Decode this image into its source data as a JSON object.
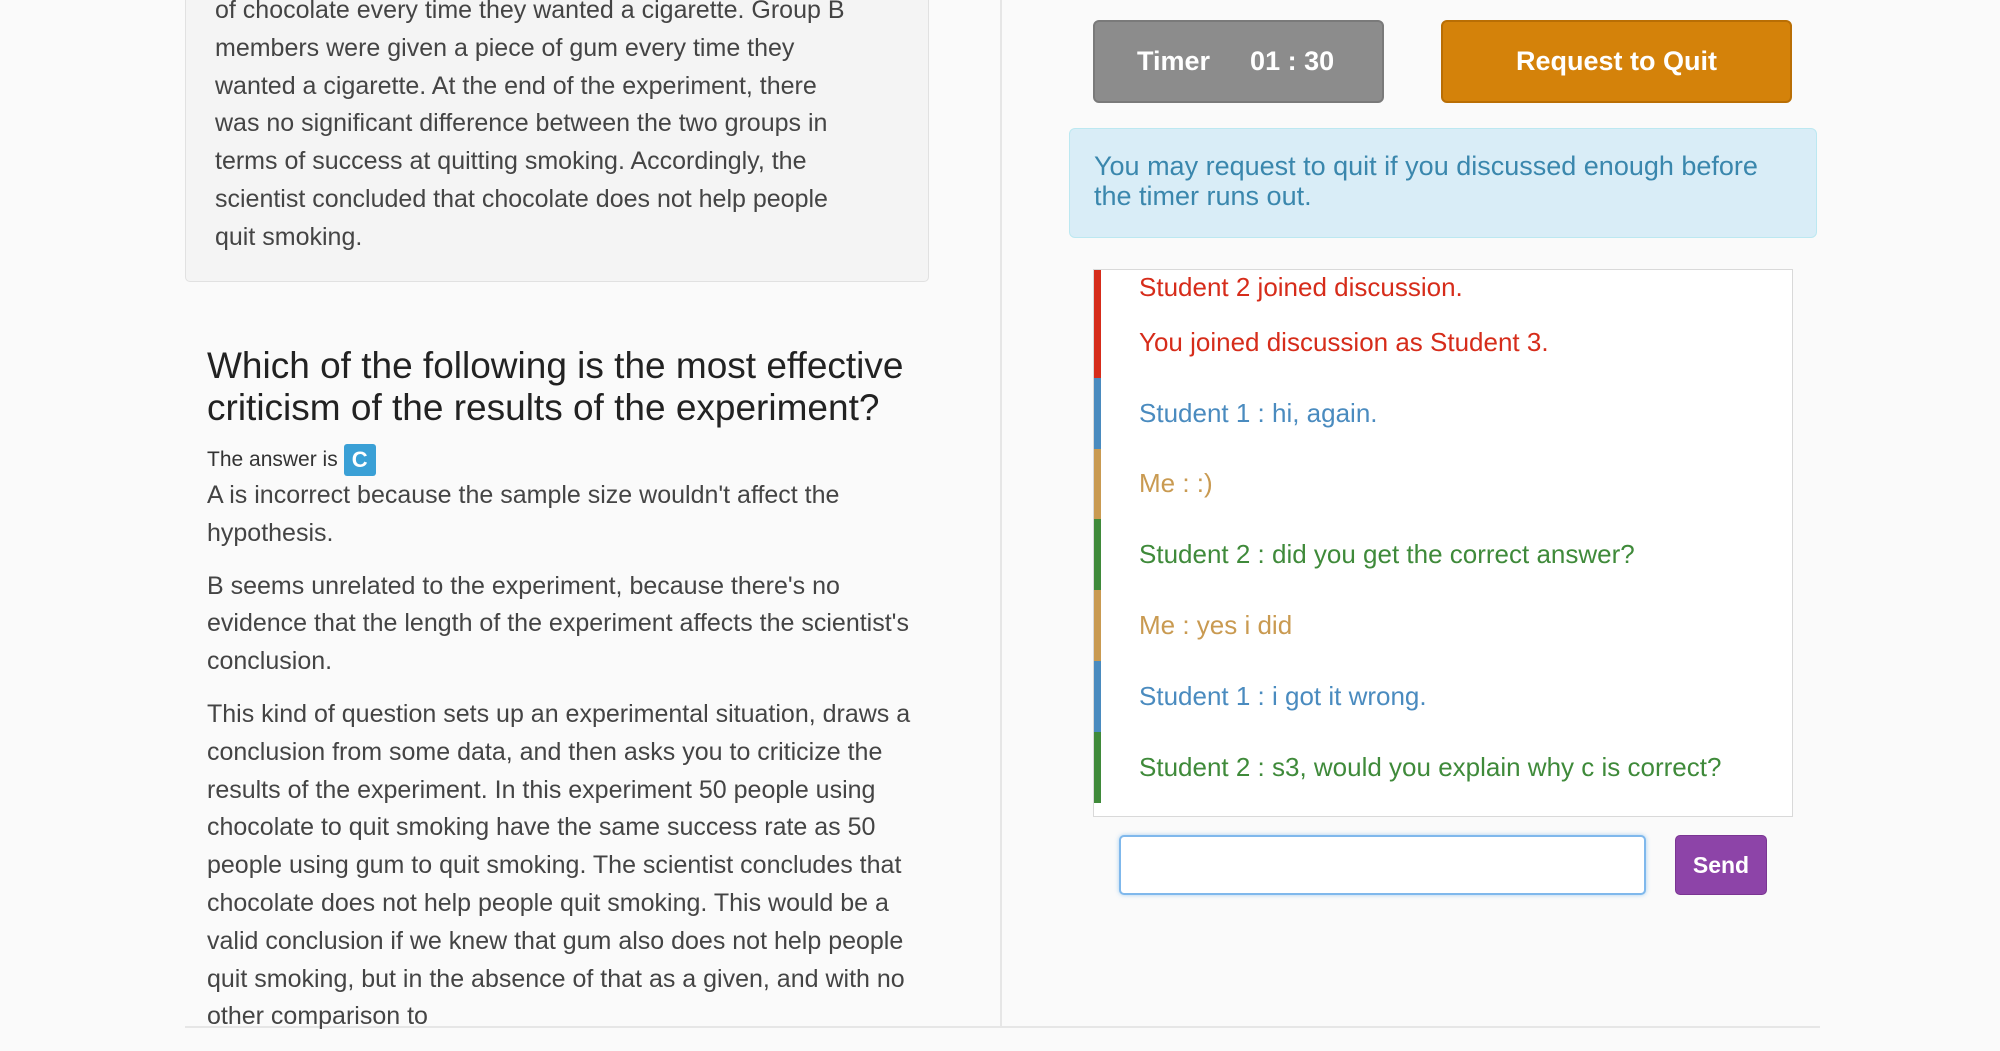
{
  "passage": {
    "lines": [
      "of chocolate every time they wanted a cigarette. Group B",
      "members were given a piece of gum every time they",
      "wanted a cigarette. At the end of the experiment, there",
      "was no significant difference between the two groups in",
      "terms of success at quitting smoking. Accordingly, the",
      "scientist concluded that chocolate does not help people",
      "quit smoking."
    ]
  },
  "question": {
    "title": "Which of the following is the most effective criticism of the results of the experiment?",
    "answer_label": "The answer is",
    "answer_value": "C"
  },
  "explanation": {
    "paragraphs": [
      "A is incorrect because the sample size wouldn't affect the hypothesis.",
      "B seems unrelated to the experiment, because there's no evidence that the length of the experiment affects the scientist's conclusion.",
      "This kind of question sets up an experimental situation, draws a conclusion from some data, and then asks you to criticize the results of the experiment. In this experiment 50 people using chocolate to quit smoking have the same success rate as 50 people using gum to quit smoking. The scientist concludes that chocolate does not help people quit smoking. This would be a valid conclusion if we knew that gum also does not help people quit smoking, but in the absence of that as a given, and with no other comparison to"
    ]
  },
  "timer": {
    "label": "Timer",
    "value": "01 : 30"
  },
  "quit_button": {
    "label": "Request to Quit"
  },
  "info_alert": {
    "text": "You may request to quit if you discussed enough before the timer runs out."
  },
  "chat": {
    "messages": [
      {
        "text": "Student 2 joined discussion.",
        "color": "#d62c1a"
      },
      {
        "text": "You joined discussion as Student 3.",
        "color": "#d62c1a"
      },
      {
        "text": "Student 1 : hi, again.",
        "color": "#4a8bbf"
      },
      {
        "text": "Me : :)",
        "color": "#c99a51"
      },
      {
        "text": "Student 2 : did you get the correct answer?",
        "color": "#3f8a3a"
      },
      {
        "text": "Me : yes i did",
        "color": "#c99a51"
      },
      {
        "text": "Student 1 : i got it wrong.",
        "color": "#4a8bbf"
      },
      {
        "text": "Student 2 : s3, would you explain why c is correct?",
        "color": "#3f8a3a"
      }
    ],
    "input_value": "",
    "send_label": "Send"
  },
  "colors": {
    "accent_quit": "#d4820a",
    "send_button": "#8d44a8",
    "answer_badge": "#3aa0d6",
    "info_background": "#d9edf7"
  }
}
